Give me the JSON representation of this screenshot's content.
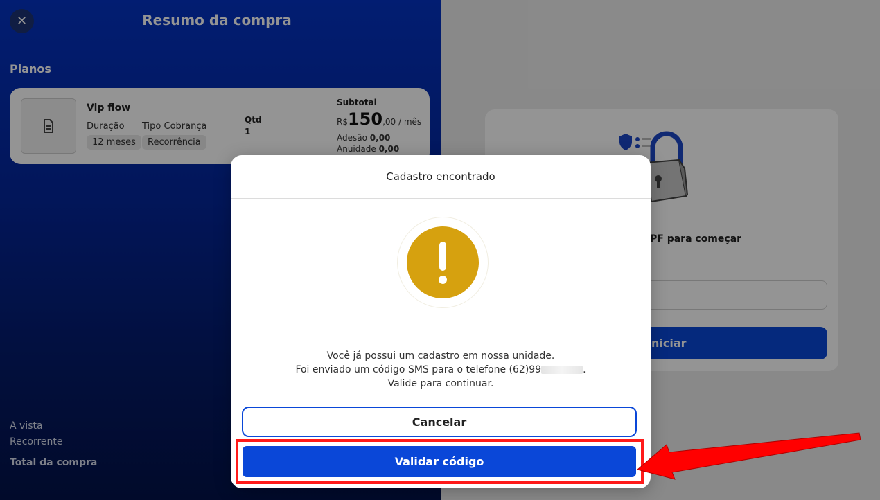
{
  "left_panel": {
    "close_icon": "close-icon",
    "title": "Resumo da compra",
    "plans_label": "Planos",
    "plan": {
      "icon": "document-icon",
      "name": "Vip flow",
      "duration_label": "Duração",
      "duration_value": "12 meses",
      "billing_label": "Tipo Cobrança",
      "billing_value": "Recorrência",
      "qty_label": "Qtd",
      "qty_value": "1",
      "subtotal_label": "Subtotal",
      "currency": "R$",
      "price_int": "150",
      "price_suffix": ",00 / mês",
      "adesao_label": "Adesão",
      "adesao_value": "0,00",
      "anuidade_label": "Anuidade",
      "anuidade_value": "0,00"
    },
    "footer": {
      "a_vista": "A vista",
      "recorrente": "Recorrente",
      "total_label": "Total da compra"
    }
  },
  "right_panel": {
    "cpf_prompt": "PF para começar",
    "start_label": "niciar",
    "illustration": "lock-shield-icon"
  },
  "modal": {
    "title": "Cadastro encontrado",
    "icon": "warning-icon",
    "message_line1": "Você já possui um cadastro em nossa unidade.",
    "message_line2_prefix": "Foi enviado um código SMS para o telefone (62)99",
    "message_line2_suffix": ".",
    "message_line3": "Valide para continuar.",
    "cancel_label": "Cancelar",
    "validate_label": "Validar código"
  },
  "colors": {
    "primary_blue": "#0a47d8",
    "warning": "#d6a10f",
    "highlight_red": "#ff1a1a"
  }
}
